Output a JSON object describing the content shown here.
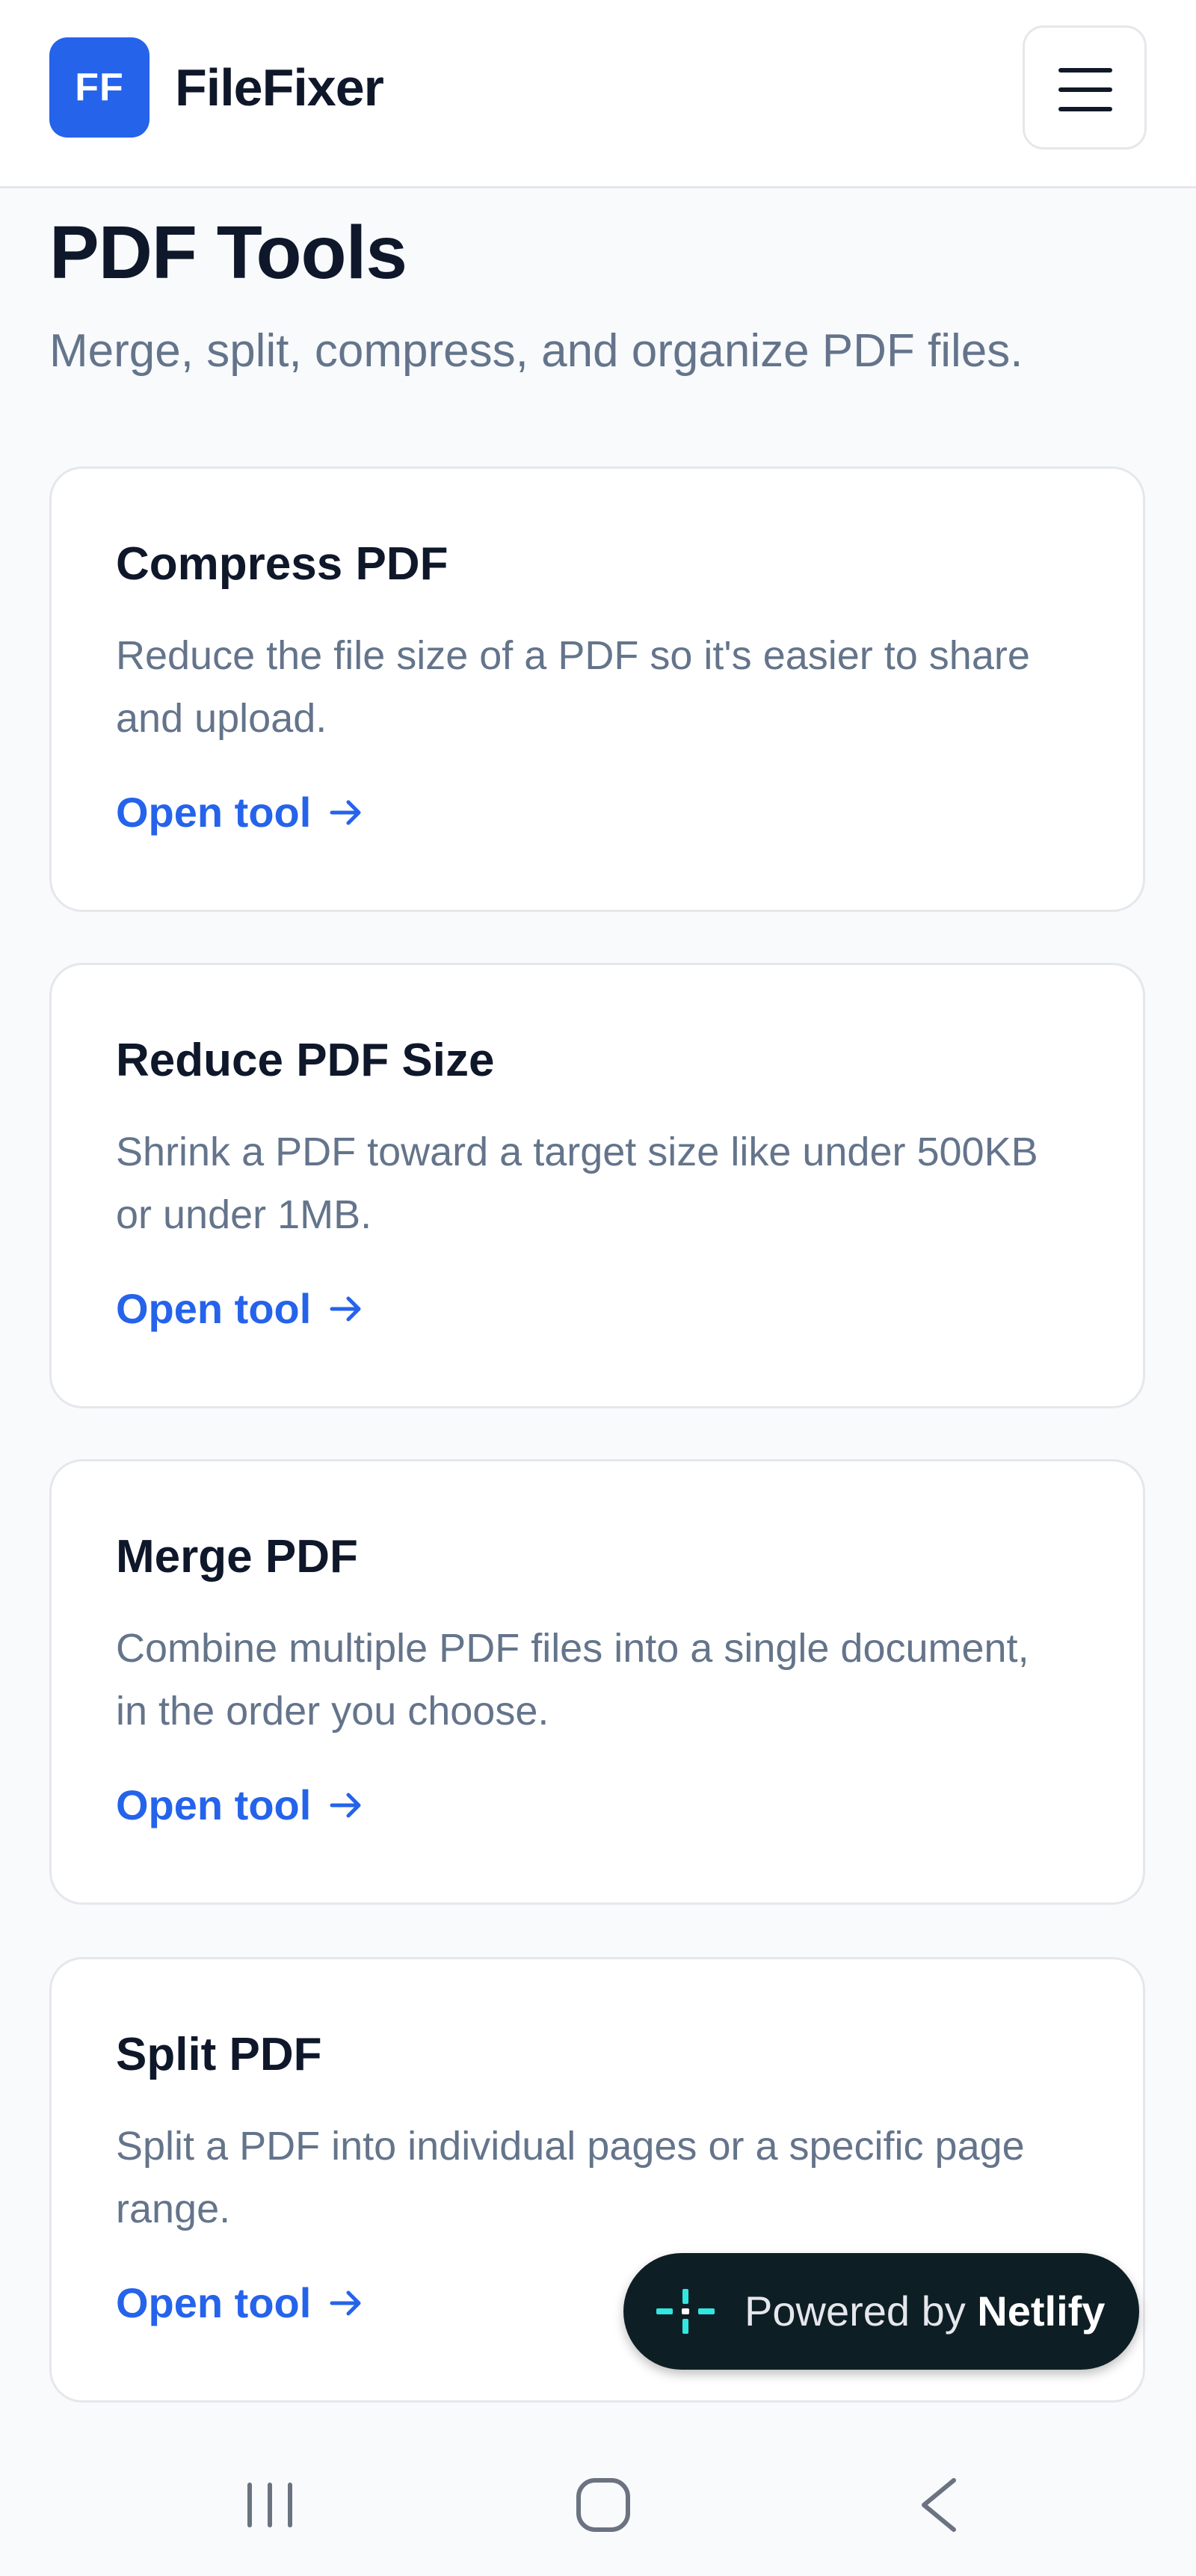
{
  "header": {
    "logo_text": "FF",
    "brand": "FileFixer",
    "menu_icon": "hamburger-menu-icon"
  },
  "main": {
    "title": "PDF Tools",
    "subtitle": "Merge, split, compress, and organize PDF files."
  },
  "tools": [
    {
      "title": "Compress PDF",
      "description": "Reduce the file size of a PDF so it's easier to share and upload.",
      "link_label": "Open tool"
    },
    {
      "title": "Reduce PDF Size",
      "description": "Shrink a PDF toward a target size like under 500KB or under 1MB.",
      "link_label": "Open tool"
    },
    {
      "title": "Merge PDF",
      "description": "Combine multiple PDF files into a single document, in the order you choose.",
      "link_label": "Open tool"
    },
    {
      "title": "Split PDF",
      "description": "Split a PDF into individual pages or a specific page range.",
      "link_label": "Open tool"
    }
  ],
  "badge": {
    "prefix": "Powered by",
    "brand": "Netlify"
  },
  "colors": {
    "accent": "#2563eb",
    "text_dark": "#0f172a",
    "text_muted": "#64748b",
    "badge_bg": "#0e1e25",
    "netlify_teal": "#32e6e2"
  },
  "system_nav": {
    "icons": [
      "recent-apps-icon",
      "home-icon",
      "back-icon"
    ]
  }
}
